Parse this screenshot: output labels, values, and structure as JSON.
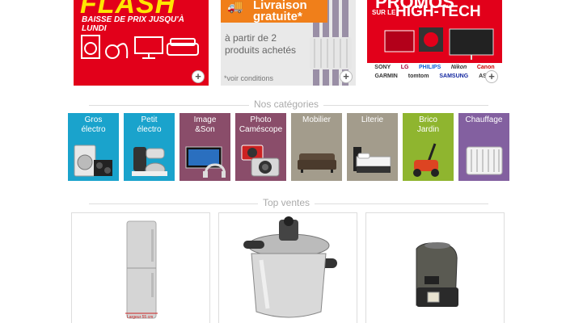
{
  "banners": [
    {
      "title": "FLASH",
      "subtitle": "BAISSE DE PRIX JUSQU'À LUNDI",
      "color": "#e2001a"
    },
    {
      "tag": "Livraison gratuite*",
      "text": "à partir de 2 produits achetés",
      "conditions": "*voir conditions",
      "color": "#f07f1a"
    },
    {
      "title_top": "PROMOS",
      "title_prefix": "SUR LE",
      "title_main": "HIGH-TECH",
      "brands_row1": [
        "SONY",
        "LG",
        "PHILIPS",
        "Nikon",
        "Canon"
      ],
      "brands_row2": [
        "GARMIN",
        "tomtom",
        "SAMSUNG",
        "ASUS"
      ],
      "color": "#e2001a"
    }
  ],
  "categories_title": "Nos catégories",
  "categories": [
    {
      "label": "Gros\nélectro",
      "color": "#1aa3cc"
    },
    {
      "label": "Petit\nélectro",
      "color": "#1aa3cc"
    },
    {
      "label": "Image\n&Son",
      "color": "#8a4d6a"
    },
    {
      "label": "Photo\nCaméscope",
      "color": "#8a4d6a"
    },
    {
      "label": "Mobilier",
      "color": "#a39c8c"
    },
    {
      "label": "Literie",
      "color": "#a39c8c"
    },
    {
      "label": "Brico\nJardin",
      "color": "#8fb52f"
    },
    {
      "label": "Chauffage",
      "color": "#8360a0"
    }
  ],
  "top_sales_title": "Top ventes",
  "products": [
    {
      "caption": "Largeur 55 cm"
    },
    {
      "caption": ""
    },
    {
      "caption": ""
    }
  ],
  "plus_symbol": "+"
}
